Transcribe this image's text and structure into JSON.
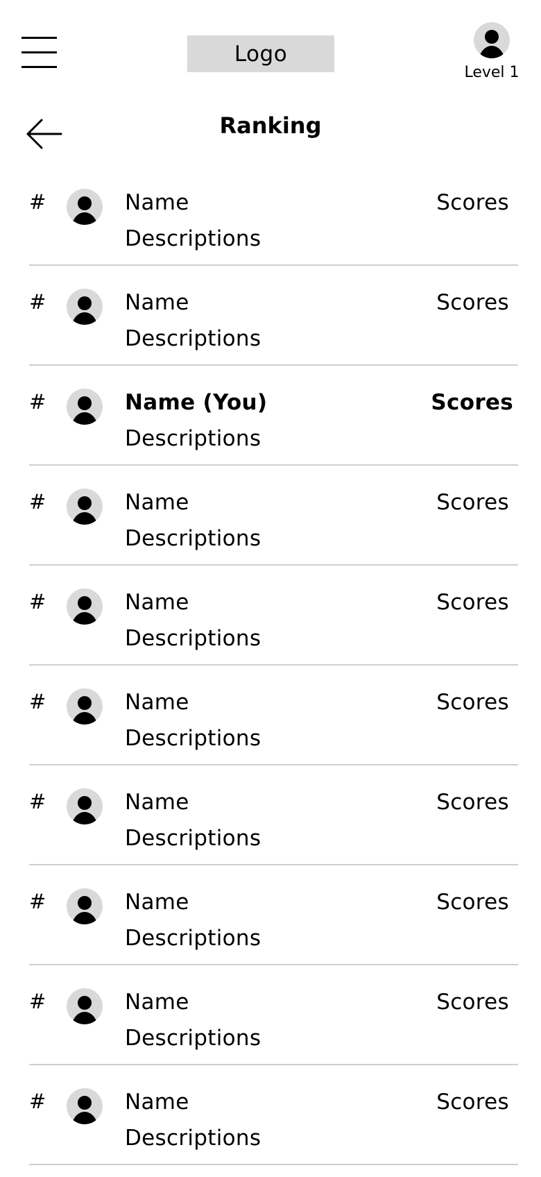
{
  "header": {
    "menu_icon": "hamburger-menu-icon",
    "logo_text": "Logo",
    "profile_icon": "user-avatar-icon",
    "level_text": "Level 1"
  },
  "titlebar": {
    "back_icon": "arrow-left-icon",
    "title": "Ranking"
  },
  "colors": {
    "avatar_bg": "#d9d9d9",
    "logo_bg": "#d9d9d9",
    "divider": "#cfcfcf",
    "text": "#000000"
  },
  "rows": [
    {
      "rank": "#",
      "name": "Name",
      "description": "Descriptions",
      "score": "Scores",
      "is_you": false
    },
    {
      "rank": "#",
      "name": "Name",
      "description": "Descriptions",
      "score": "Scores",
      "is_you": false
    },
    {
      "rank": "#",
      "name": "Name (You)",
      "description": "Descriptions",
      "score": "Scores",
      "is_you": true
    },
    {
      "rank": "#",
      "name": "Name",
      "description": "Descriptions",
      "score": "Scores",
      "is_you": false
    },
    {
      "rank": "#",
      "name": "Name",
      "description": "Descriptions",
      "score": "Scores",
      "is_you": false
    },
    {
      "rank": "#",
      "name": "Name",
      "description": "Descriptions",
      "score": "Scores",
      "is_you": false
    },
    {
      "rank": "#",
      "name": "Name",
      "description": "Descriptions",
      "score": "Scores",
      "is_you": false
    },
    {
      "rank": "#",
      "name": "Name",
      "description": "Descriptions",
      "score": "Scores",
      "is_you": false
    },
    {
      "rank": "#",
      "name": "Name",
      "description": "Descriptions",
      "score": "Scores",
      "is_you": false
    },
    {
      "rank": "#",
      "name": "Name",
      "description": "Descriptions",
      "score": "Scores",
      "is_you": false
    }
  ]
}
